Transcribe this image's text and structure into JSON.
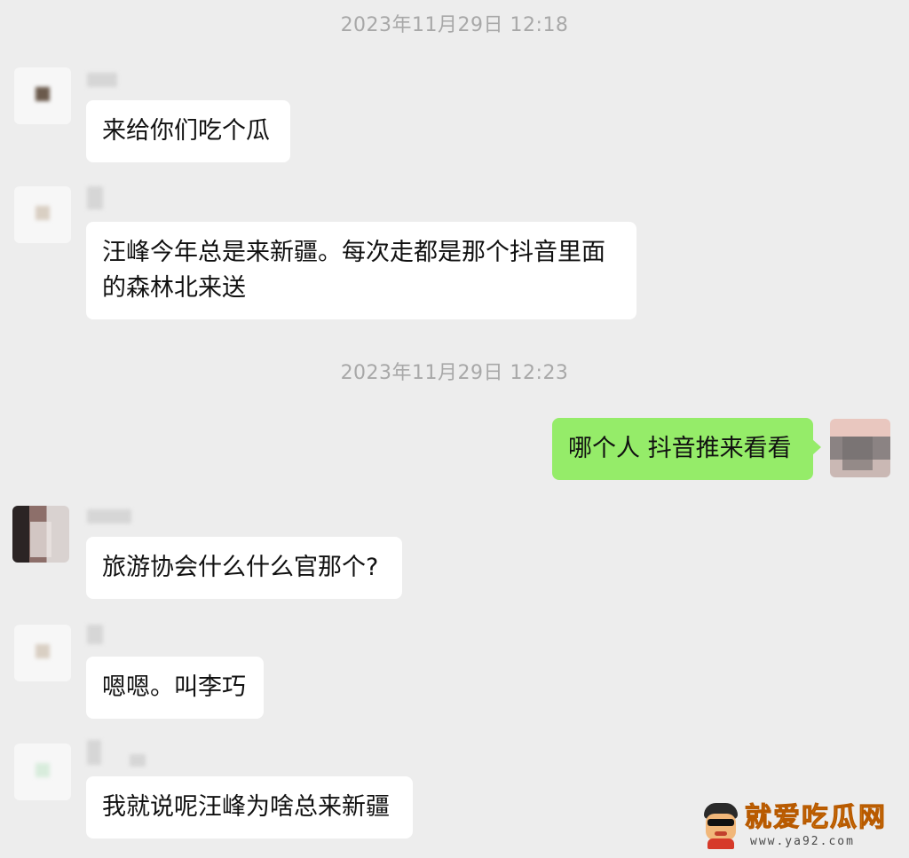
{
  "timestamps": [
    "2023年11月29日 12:18",
    "2023年11月29日 12:23"
  ],
  "messages": [
    {
      "text": "来给你们吃个瓜"
    },
    {
      "text": "汪峰今年总是来新疆。每次走都是那个抖音里面\n的森林北来送"
    },
    {
      "text": "哪个人 抖音推来看看"
    },
    {
      "text": "旅游协会什么什么官那个?"
    },
    {
      "text": "嗯嗯。叫李巧"
    },
    {
      "text": "我就说呢汪峰为啥总来新疆"
    }
  ],
  "colors": {
    "background": "#ededed",
    "incoming_bubble": "#ffffff",
    "outgoing_bubble": "#95ec69",
    "timestamp_text": "#a8a8a8"
  },
  "watermark": {
    "title": "就爱吃瓜网",
    "url": "www.ya92.com",
    "icon": "cartoon-face-with-sunglasses-icon"
  }
}
